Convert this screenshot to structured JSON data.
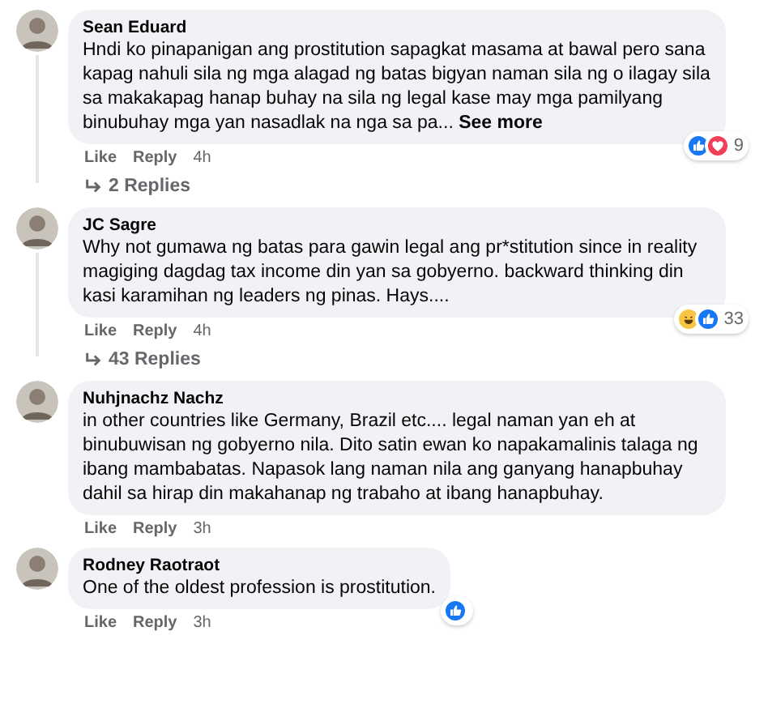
{
  "comments": [
    {
      "author": "Sean Eduard",
      "text": "Hndi ko pinapanigan ang prostitution sapagkat masama at bawal pero sana kapag nahuli sila ng mga alagad ng batas bigyan naman sila ng o ilagay sila sa makakapag hanap buhay na sila ng legal kase may mga pamilyang binubuhay mga yan nasadlak na nga sa pa...",
      "see_more": "See more",
      "actions": [
        "Like",
        "Reply"
      ],
      "time": "4h",
      "reactions": [
        {
          "kind": "like"
        },
        {
          "kind": "love"
        }
      ],
      "reaction_count": "9",
      "replies": "2 Replies"
    },
    {
      "author": "JC Sagre",
      "text": "Why not gumawa ng batas para gawin legal ang pr*stitution since in reality magiging dagdag tax income din yan sa gobyerno. backward thinking din kasi karamihan ng leaders ng pinas. Hays....",
      "actions": [
        "Like",
        "Reply"
      ],
      "time": "4h",
      "reactions": [
        {
          "kind": "haha"
        },
        {
          "kind": "like"
        }
      ],
      "reaction_count": "33",
      "replies": "43 Replies"
    },
    {
      "author": "Nuhjnachz Nachz",
      "text": "in other countries like Germany, Brazil etc.... legal naman yan eh at binubuwisan ng gobyerno nila. Dito satin ewan ko napakamalinis talaga ng ibang mambabatas. Napasok lang naman nila ang ganyang hanapbuhay dahil sa hirap din makahanap ng trabaho at ibang hanapbuhay.",
      "actions": [
        "Like",
        "Reply"
      ],
      "time": "3h"
    },
    {
      "author": "Rodney Raotraot",
      "text": "One of the oldest profession is prostitution.",
      "actions": [
        "Like",
        "Reply"
      ],
      "time": "3h",
      "reactions": [
        {
          "kind": "like"
        }
      ]
    }
  ]
}
